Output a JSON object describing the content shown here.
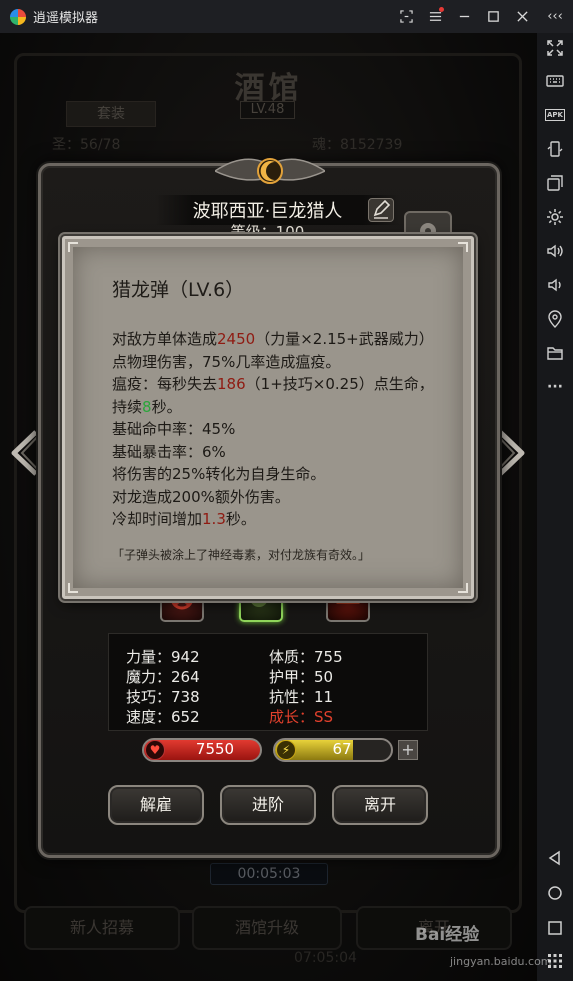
{
  "window": {
    "app_title": "逍遥模拟器",
    "controls": [
      "fullscreen-icon",
      "menu-icon",
      "minimize-icon",
      "maximize-icon",
      "close-icon",
      "collapse-icon"
    ],
    "collapse_label": "‹‹‹"
  },
  "sidebar": {
    "apk_label": "APK",
    "items": [
      "expand-icon",
      "keyboard-icon",
      "apk-icon",
      "rotate-icon",
      "multi-window-icon",
      "settings-icon",
      "volume-up-icon",
      "volume-down-icon",
      "location-icon",
      "folder-icon",
      "more-icon",
      "back-icon",
      "home-icon",
      "recents-icon"
    ],
    "more_label": "···"
  },
  "background": {
    "title": "酒馆",
    "level": "LV.48",
    "tab_suit": "套装",
    "count_prefix": "圣",
    "count": "56/78",
    "soul_label": "魂：8152739",
    "timer_top": "00:05:03",
    "timer_bottom": "07:05:04",
    "buttons": [
      "新人招募",
      "酒馆升级",
      "离开"
    ]
  },
  "hero": {
    "name": "波耶西亚·巨龙猎人",
    "level": "等级：100",
    "stats": {
      "strength": "力量：942",
      "constitution": "体质：755",
      "magic": "魔力：264",
      "armor": "护甲：50",
      "skill": "技巧：738",
      "resist": "抗性：11",
      "speed": "速度：652",
      "growth": "成长：SS"
    },
    "hp": "7550",
    "energy": "67",
    "energy_fraction": 0.67,
    "buttons": {
      "dismiss": "解雇",
      "advance": "进阶",
      "leave": "离开"
    }
  },
  "tooltip": {
    "title": "猎龙弹（LV.6）",
    "line1_a": "对敌方单体造成",
    "line1_dmg": "2450",
    "line1_b": "（力量×2.15+武器威力）点物理伤害，75%几率造成瘟疫。",
    "line2_a": "瘟疫：每秒失去",
    "line2_val": "186",
    "line2_b": "（1+技巧×0.25）点生命，持续",
    "line2_dur": "8",
    "line2_c": "秒。",
    "line3": "基础命中率：45%",
    "line4": "基础暴击率：6%",
    "line5": "将伤害的25%转化为自身生命。",
    "line6": "对龙造成200%额外伤害。",
    "line7_a": "冷却时间增加",
    "line7_val": "1.3",
    "line7_b": "秒。",
    "quote": "「子弹头被涂上了神经毒素，对付龙族有奇效。」"
  },
  "watermark": {
    "brand": "Bai经验",
    "url": "jingyan.baidu.com"
  },
  "colors": {
    "damage_red": "#8f1b12",
    "duration_green": "#2aa63a",
    "growth_red": "#e0402c",
    "hp_red": "#d32f2f",
    "energy_yellow": "#d4c12e"
  }
}
